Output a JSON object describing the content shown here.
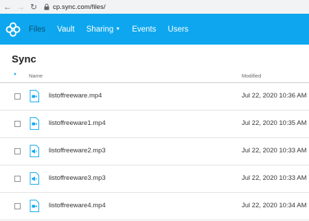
{
  "browser": {
    "url": "cp.sync.com/files/"
  },
  "nav": {
    "items": [
      {
        "label": "Files",
        "active": true
      },
      {
        "label": "Vault",
        "active": false
      },
      {
        "label": "Sharing",
        "active": false,
        "dropdown": true
      },
      {
        "label": "Events",
        "active": false
      },
      {
        "label": "Users",
        "active": false
      }
    ]
  },
  "page": {
    "title": "Sync"
  },
  "table": {
    "columns": {
      "name": "Name",
      "modified": "Modified"
    },
    "rows": [
      {
        "name": "listoffreeware.mp4",
        "modified": "Jul 22, 2020 10:36 AM",
        "type": "video"
      },
      {
        "name": "listoffreeware1.mp4",
        "modified": "Jul 22, 2020 10:35 AM",
        "type": "video"
      },
      {
        "name": "listoffreeware2.mp3",
        "modified": "Jul 22, 2020 10:33 AM",
        "type": "audio"
      },
      {
        "name": "listoffreeware3.mp3",
        "modified": "Jul 22, 2020 10:33 AM",
        "type": "audio"
      },
      {
        "name": "listoffreeware4.mp4",
        "modified": "Jul 22, 2020 10:34 AM",
        "type": "video"
      }
    ]
  },
  "colors": {
    "brand": "#0ea7ef",
    "active_nav": "#0a4f74"
  }
}
